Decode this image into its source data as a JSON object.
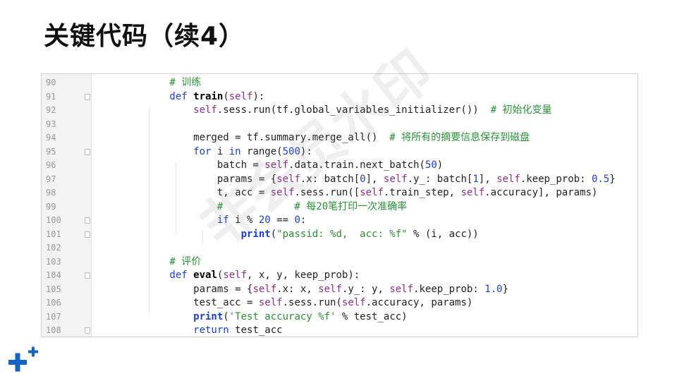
{
  "slide": {
    "title": "关键代码（续4）"
  },
  "watermark": {
    "text": "非会员水印"
  },
  "code": {
    "lines": [
      {
        "num": "90",
        "fold": false,
        "tokens": [
          [
            "c",
            "        # 训练"
          ]
        ]
      },
      {
        "num": "91",
        "fold": true,
        "tokens": [
          [
            "k",
            "        def "
          ],
          [
            "fn",
            "train"
          ],
          [
            "op",
            "("
          ],
          [
            "sf",
            "self"
          ],
          [
            "op",
            "):"
          ]
        ]
      },
      {
        "num": "92",
        "fold": false,
        "tokens": [
          [
            "sf",
            "            self"
          ],
          [
            "op",
            ".sess.run(tf.global_variables_initializer())  "
          ],
          [
            "c",
            "# 初始化变量"
          ]
        ]
      },
      {
        "num": "93",
        "fold": false,
        "tokens": []
      },
      {
        "num": "94",
        "fold": false,
        "tokens": [
          [
            "op",
            "            merged = tf.summary.merge_all()  "
          ],
          [
            "c",
            "# 将所有的摘要信息保存到磁盘"
          ]
        ]
      },
      {
        "num": "95",
        "fold": true,
        "tokens": [
          [
            "k",
            "            for "
          ],
          [
            "op",
            "i "
          ],
          [
            "k",
            "in "
          ],
          [
            "op",
            "range("
          ],
          [
            "n",
            "500"
          ],
          [
            "op",
            "):"
          ]
        ]
      },
      {
        "num": "96",
        "fold": false,
        "tokens": [
          [
            "op",
            "                batch = "
          ],
          [
            "sf",
            "self"
          ],
          [
            "op",
            ".data.train.next_batch("
          ],
          [
            "n",
            "50"
          ],
          [
            "op",
            ")"
          ]
        ]
      },
      {
        "num": "97",
        "fold": false,
        "tokens": [
          [
            "op",
            "                params = {"
          ],
          [
            "sf",
            "self"
          ],
          [
            "op",
            ".x: batch["
          ],
          [
            "n",
            "0"
          ],
          [
            "op",
            "], "
          ],
          [
            "sf",
            "self"
          ],
          [
            "op",
            ".y_: batch["
          ],
          [
            "n",
            "1"
          ],
          [
            "op",
            "], "
          ],
          [
            "sf",
            "self"
          ],
          [
            "op",
            ".keep_prob: "
          ],
          [
            "n",
            "0.5"
          ],
          [
            "op",
            "}"
          ]
        ]
      },
      {
        "num": "98",
        "fold": false,
        "tokens": [
          [
            "op",
            "                t, acc = "
          ],
          [
            "sf",
            "self"
          ],
          [
            "op",
            ".sess.run(["
          ],
          [
            "sf",
            "self"
          ],
          [
            "op",
            ".train_step, "
          ],
          [
            "sf",
            "self"
          ],
          [
            "op",
            ".accuracy], params)"
          ]
        ]
      },
      {
        "num": "99",
        "fold": false,
        "tokens": [
          [
            "c",
            "                #            # 每20笔打印一次准确率"
          ]
        ]
      },
      {
        "num": "100",
        "fold": true,
        "tokens": [
          [
            "k",
            "                if "
          ],
          [
            "op",
            "i % "
          ],
          [
            "n",
            "20"
          ],
          [
            "op",
            " == "
          ],
          [
            "n",
            "0"
          ],
          [
            "op",
            ":"
          ]
        ]
      },
      {
        "num": "101",
        "fold": true,
        "tokens": [
          [
            "bf",
            "                    print"
          ],
          [
            "op",
            "("
          ],
          [
            "s",
            "\"passid: %d,  acc: %f\""
          ],
          [
            "op",
            " % (i, acc))"
          ]
        ]
      },
      {
        "num": "102",
        "fold": false,
        "tokens": []
      },
      {
        "num": "103",
        "fold": false,
        "tokens": [
          [
            "c",
            "        # 评价"
          ]
        ]
      },
      {
        "num": "104",
        "fold": true,
        "tokens": [
          [
            "k",
            "        def "
          ],
          [
            "fn",
            "eval"
          ],
          [
            "op",
            "("
          ],
          [
            "sf",
            "self"
          ],
          [
            "op",
            ", x, y, keep_prob):"
          ]
        ]
      },
      {
        "num": "105",
        "fold": false,
        "tokens": [
          [
            "op",
            "            params = {"
          ],
          [
            "sf",
            "self"
          ],
          [
            "op",
            ".x: x, "
          ],
          [
            "sf",
            "self"
          ],
          [
            "op",
            ".y_: y, "
          ],
          [
            "sf",
            "self"
          ],
          [
            "op",
            ".keep_prob: "
          ],
          [
            "n",
            "1.0"
          ],
          [
            "op",
            "}"
          ]
        ]
      },
      {
        "num": "106",
        "fold": false,
        "tokens": [
          [
            "op",
            "            test_acc = "
          ],
          [
            "sf",
            "self"
          ],
          [
            "op",
            ".sess.run("
          ],
          [
            "sf",
            "self"
          ],
          [
            "op",
            ".accuracy, params)"
          ]
        ]
      },
      {
        "num": "107",
        "fold": false,
        "tokens": [
          [
            "bf",
            "            print"
          ],
          [
            "op",
            "("
          ],
          [
            "s",
            "'Test accuracy %f'"
          ],
          [
            "op",
            " % test_acc)"
          ]
        ]
      },
      {
        "num": "108",
        "fold": true,
        "tokens": [
          [
            "k",
            "            return "
          ],
          [
            "op",
            "test_acc"
          ]
        ]
      }
    ]
  },
  "colors": {
    "keyword": "#1e3fc7",
    "self": "#8a2e86",
    "comment": "#2b8f3a",
    "string": "#2f8b35",
    "number": "#1e3fc7",
    "logo_blue": "#1565c0"
  },
  "icons": {
    "logo": "plus-logo-icon"
  }
}
